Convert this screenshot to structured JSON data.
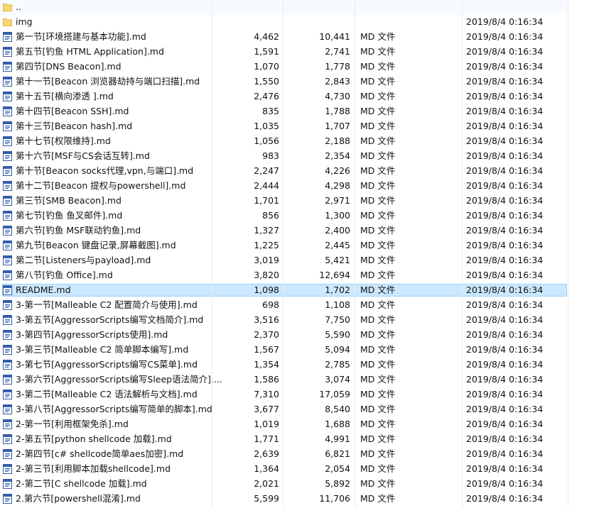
{
  "listing": {
    "parent": {
      "label": ".."
    },
    "folder": {
      "name": "img",
      "modified": "2019/8/4 0:16:34"
    },
    "files": [
      {
        "name": "第一节[环境搭建与基本功能].md",
        "size1": "4,462",
        "size2": "10,441",
        "type": "MD 文件",
        "modified": "2019/8/4 0:16:34"
      },
      {
        "name": "第五节[钓鱼 HTML Application].md",
        "size1": "1,591",
        "size2": "2,741",
        "type": "MD 文件",
        "modified": "2019/8/4 0:16:34"
      },
      {
        "name": "第四节[DNS Beacon].md",
        "size1": "1,070",
        "size2": "1,778",
        "type": "MD 文件",
        "modified": "2019/8/4 0:16:34"
      },
      {
        "name": "第十一节[Beacon 浏览器劫持与端口扫描].md",
        "size1": "1,550",
        "size2": "2,843",
        "type": "MD 文件",
        "modified": "2019/8/4 0:16:34"
      },
      {
        "name": "第十五节[横向渗透 ].md",
        "size1": "2,476",
        "size2": "4,730",
        "type": "MD 文件",
        "modified": "2019/8/4 0:16:34"
      },
      {
        "name": "第十四节[Beacon SSH].md",
        "size1": "835",
        "size2": "1,788",
        "type": "MD 文件",
        "modified": "2019/8/4 0:16:34"
      },
      {
        "name": "第十三节[Beacon hash].md",
        "size1": "1,035",
        "size2": "1,707",
        "type": "MD 文件",
        "modified": "2019/8/4 0:16:34"
      },
      {
        "name": "第十七节[权限维持].md",
        "size1": "1,056",
        "size2": "2,188",
        "type": "MD 文件",
        "modified": "2019/8/4 0:16:34"
      },
      {
        "name": "第十六节[MSF与CS会话互转].md",
        "size1": "983",
        "size2": "2,354",
        "type": "MD 文件",
        "modified": "2019/8/4 0:16:34"
      },
      {
        "name": "第十节[Beacon socks代理,vpn,与端口].md",
        "size1": "2,247",
        "size2": "4,226",
        "type": "MD 文件",
        "modified": "2019/8/4 0:16:34"
      },
      {
        "name": "第十二节[Beacon 提权与powershell].md",
        "size1": "2,444",
        "size2": "4,298",
        "type": "MD 文件",
        "modified": "2019/8/4 0:16:34"
      },
      {
        "name": "第三节[SMB Beacon].md",
        "size1": "1,701",
        "size2": "2,971",
        "type": "MD 文件",
        "modified": "2019/8/4 0:16:34"
      },
      {
        "name": "第七节[钓鱼 鱼叉邮件].md",
        "size1": "856",
        "size2": "1,300",
        "type": "MD 文件",
        "modified": "2019/8/4 0:16:34"
      },
      {
        "name": "第六节[钓鱼 MSF联动钓鱼].md",
        "size1": "1,327",
        "size2": "2,400",
        "type": "MD 文件",
        "modified": "2019/8/4 0:16:34"
      },
      {
        "name": "第九节[Beacon 键盘记录,屏幕截图].md",
        "size1": "1,225",
        "size2": "2,445",
        "type": "MD 文件",
        "modified": "2019/8/4 0:16:34"
      },
      {
        "name": "第二节[Listeners与payload].md",
        "size1": "3,019",
        "size2": "5,421",
        "type": "MD 文件",
        "modified": "2019/8/4 0:16:34"
      },
      {
        "name": "第八节[钓鱼 Office].md",
        "size1": "3,820",
        "size2": "12,694",
        "type": "MD 文件",
        "modified": "2019/8/4 0:16:34"
      },
      {
        "name": "README.md",
        "size1": "1,098",
        "size2": "1,702",
        "type": "MD 文件",
        "modified": "2019/8/4 0:16:34",
        "selected": true
      },
      {
        "name": "3-第一节[Malleable C2 配置简介与使用].md",
        "size1": "698",
        "size2": "1,108",
        "type": "MD 文件",
        "modified": "2019/8/4 0:16:34"
      },
      {
        "name": "3-第五节[AggressorScripts编写文档简介].md",
        "size1": "3,516",
        "size2": "7,750",
        "type": "MD 文件",
        "modified": "2019/8/4 0:16:34"
      },
      {
        "name": "3-第四节[AggressorScripts使用].md",
        "size1": "2,370",
        "size2": "5,590",
        "type": "MD 文件",
        "modified": "2019/8/4 0:16:34"
      },
      {
        "name": "3-第三节[Malleable C2 简单脚本编写].md",
        "size1": "1,567",
        "size2": "5,094",
        "type": "MD 文件",
        "modified": "2019/8/4 0:16:34"
      },
      {
        "name": "3-第七节[AggressorScripts编写CS菜单].md",
        "size1": "1,354",
        "size2": "2,785",
        "type": "MD 文件",
        "modified": "2019/8/4 0:16:34"
      },
      {
        "name": "3-第六节[AggressorScripts编写Sleep语法简介]....",
        "size1": "1,586",
        "size2": "3,074",
        "type": "MD 文件",
        "modified": "2019/8/4 0:16:34"
      },
      {
        "name": "3-第二节[Malleable C2 语法解析与文档].md",
        "size1": "7,310",
        "size2": "17,059",
        "type": "MD 文件",
        "modified": "2019/8/4 0:16:34"
      },
      {
        "name": "3-第八节[AggressorScripts编写简单的脚本].md",
        "size1": "3,677",
        "size2": "8,540",
        "type": "MD 文件",
        "modified": "2019/8/4 0:16:34"
      },
      {
        "name": "2-第一节[利用框架免杀].md",
        "size1": "1,019",
        "size2": "1,688",
        "type": "MD 文件",
        "modified": "2019/8/4 0:16:34"
      },
      {
        "name": "2-第五节[python shellcode 加载].md",
        "size1": "1,771",
        "size2": "4,991",
        "type": "MD 文件",
        "modified": "2019/8/4 0:16:34"
      },
      {
        "name": "2-第四节[c# shellcode简单aes加密].md",
        "size1": "2,639",
        "size2": "6,821",
        "type": "MD 文件",
        "modified": "2019/8/4 0:16:34"
      },
      {
        "name": "2-第三节[利用脚本加载shellcode].md",
        "size1": "1,364",
        "size2": "2,054",
        "type": "MD 文件",
        "modified": "2019/8/4 0:16:34"
      },
      {
        "name": "2-第二节[C shellcode 加载].md",
        "size1": "2,021",
        "size2": "5,892",
        "type": "MD 文件",
        "modified": "2019/8/4 0:16:34"
      },
      {
        "name": "2.第六节[powershell混淆].md",
        "size1": "5,599",
        "size2": "11,706",
        "type": "MD 文件",
        "modified": "2019/8/4 0:16:34"
      }
    ]
  }
}
